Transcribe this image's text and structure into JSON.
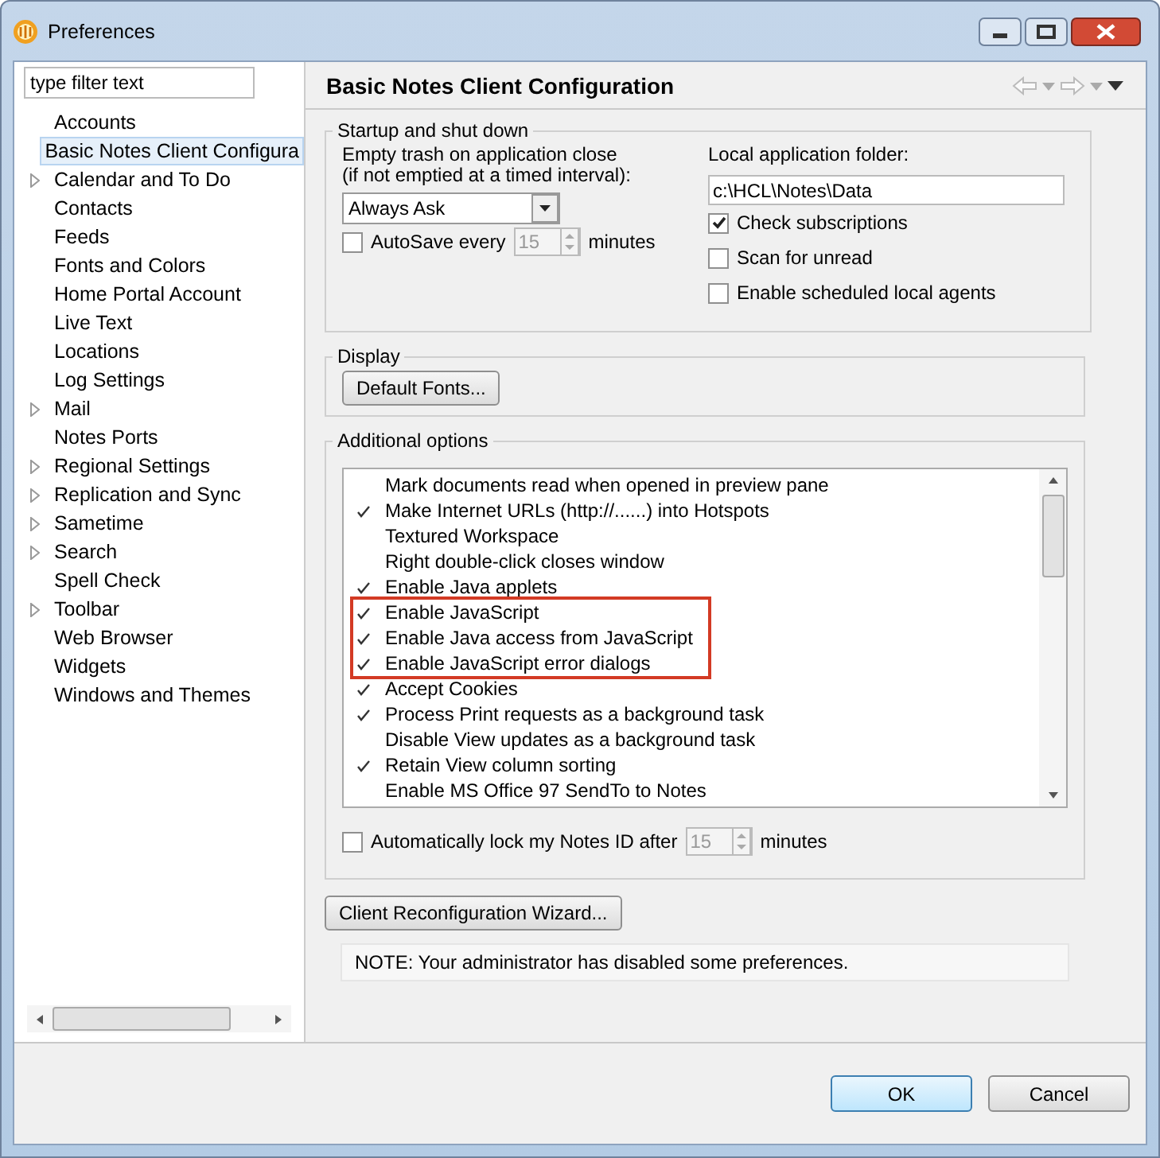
{
  "window": {
    "title": "Preferences"
  },
  "filter": {
    "placeholder": "type filter text"
  },
  "sidebar": {
    "items": [
      {
        "label": "Accounts",
        "expandable": false,
        "selected": false
      },
      {
        "label": "Basic Notes Client Configura",
        "expandable": false,
        "selected": true
      },
      {
        "label": "Calendar and To Do",
        "expandable": true,
        "selected": false
      },
      {
        "label": "Contacts",
        "expandable": false,
        "selected": false
      },
      {
        "label": "Feeds",
        "expandable": false,
        "selected": false
      },
      {
        "label": "Fonts and Colors",
        "expandable": false,
        "selected": false
      },
      {
        "label": "Home Portal Account",
        "expandable": false,
        "selected": false
      },
      {
        "label": "Live Text",
        "expandable": false,
        "selected": false
      },
      {
        "label": "Locations",
        "expandable": false,
        "selected": false
      },
      {
        "label": "Log Settings",
        "expandable": false,
        "selected": false
      },
      {
        "label": "Mail",
        "expandable": true,
        "selected": false
      },
      {
        "label": "Notes Ports",
        "expandable": false,
        "selected": false
      },
      {
        "label": "Regional Settings",
        "expandable": true,
        "selected": false
      },
      {
        "label": "Replication and Sync",
        "expandable": true,
        "selected": false
      },
      {
        "label": "Sametime",
        "expandable": true,
        "selected": false
      },
      {
        "label": "Search",
        "expandable": true,
        "selected": false
      },
      {
        "label": "Spell Check",
        "expandable": false,
        "selected": false
      },
      {
        "label": "Toolbar",
        "expandable": true,
        "selected": false
      },
      {
        "label": "Web Browser",
        "expandable": false,
        "selected": false
      },
      {
        "label": "Widgets",
        "expandable": false,
        "selected": false
      },
      {
        "label": "Windows and Themes",
        "expandable": false,
        "selected": false
      }
    ]
  },
  "page": {
    "title": "Basic Notes Client Configuration",
    "startup": {
      "title": "Startup and shut down",
      "trash_label": "Empty trash on application close",
      "trash_hint": "(if not emptied at a timed interval):",
      "trash_value": "Always Ask",
      "autosave": {
        "label": "AutoSave every",
        "checked": false,
        "value": "15",
        "disabled": true,
        "unit": "minutes"
      },
      "folder_label": "Local application folder:",
      "folder_value": "c:\\HCL\\Notes\\Data",
      "checkboxes": [
        {
          "label": "Check subscriptions",
          "checked": true
        },
        {
          "label": "Scan for unread",
          "checked": false
        },
        {
          "label": "Enable scheduled local agents",
          "checked": false
        }
      ]
    },
    "display": {
      "title": "Display",
      "button": "Default Fonts..."
    },
    "additional": {
      "title": "Additional options",
      "groups": [
        {
          "highlighted": false,
          "items": [
            {
              "label": "Mark documents read when opened in preview pane",
              "checked": false
            },
            {
              "label": "Make Internet URLs (http://......) into Hotspots",
              "checked": true
            },
            {
              "label": "Textured Workspace",
              "checked": false
            },
            {
              "label": "Right double-click closes window",
              "checked": false
            },
            {
              "label": "Enable Java applets",
              "checked": true
            }
          ]
        },
        {
          "highlighted": true,
          "items": [
            {
              "label": "Enable JavaScript",
              "checked": true
            },
            {
              "label": "Enable Java access from JavaScript",
              "checked": true
            },
            {
              "label": "Enable JavaScript error dialogs",
              "checked": true
            }
          ]
        },
        {
          "highlighted": false,
          "items": [
            {
              "label": "Accept Cookies",
              "checked": true
            },
            {
              "label": "Process Print requests as a background task",
              "checked": true
            },
            {
              "label": "Disable View updates as a background task",
              "checked": false
            },
            {
              "label": "Retain View column sorting",
              "checked": true
            },
            {
              "label": "Enable MS Office 97 SendTo to Notes",
              "checked": false
            }
          ]
        }
      ],
      "lock": {
        "label": "Automatically lock my Notes ID after",
        "checked": false,
        "value": "15",
        "disabled": true,
        "unit": "minutes"
      }
    },
    "wizard_button": "Client Reconfiguration Wizard...",
    "note": "NOTE: Your administrator has disabled some preferences."
  },
  "buttons": [
    {
      "label": "OK",
      "default": true
    },
    {
      "label": "Cancel",
      "default": false
    }
  ]
}
